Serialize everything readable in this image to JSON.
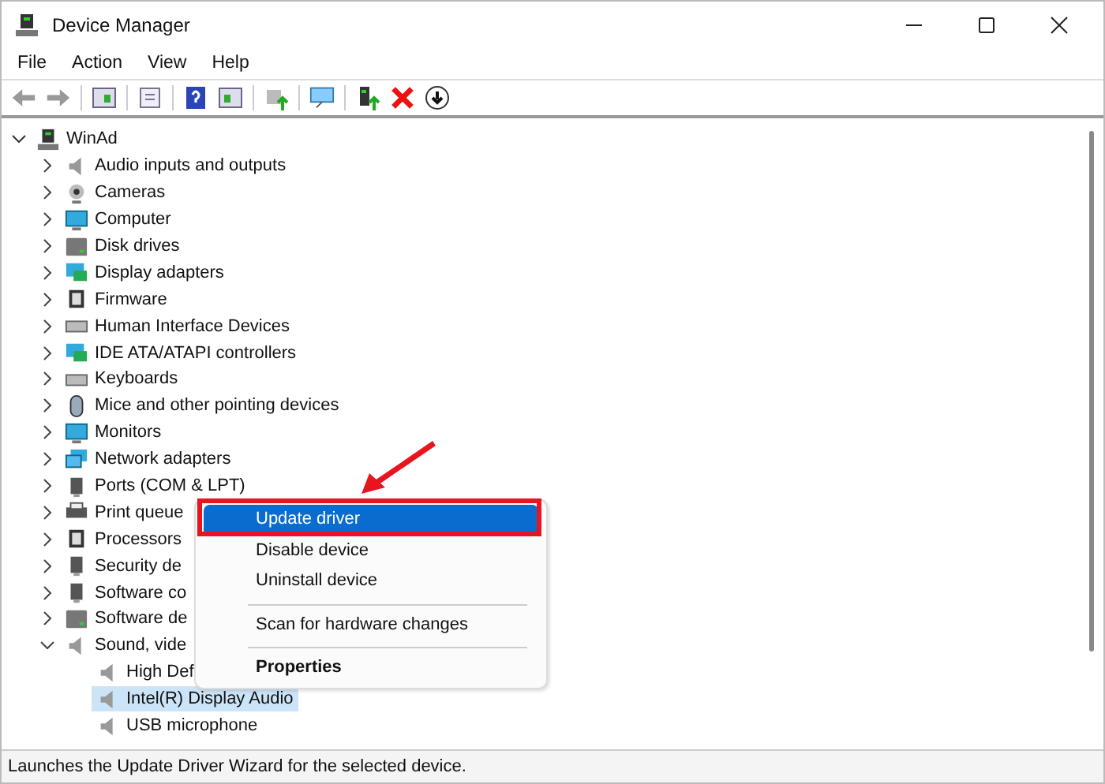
{
  "window": {
    "title": "Device Manager"
  },
  "menu_bar": [
    "File",
    "Action",
    "View",
    "Help"
  ],
  "tree": {
    "label": "WinAd",
    "expanded": true,
    "children": [
      {
        "label": "Audio inputs and outputs",
        "kind": "speaker",
        "expanded": false
      },
      {
        "label": "Cameras",
        "kind": "camera",
        "expanded": false
      },
      {
        "label": "Computer",
        "kind": "monitor",
        "expanded": false
      },
      {
        "label": "Disk drives",
        "kind": "disk",
        "expanded": false
      },
      {
        "label": "Display adapters",
        "kind": "adapter",
        "expanded": false
      },
      {
        "label": "Firmware",
        "kind": "chip",
        "expanded": false
      },
      {
        "label": "Human Interface Devices",
        "kind": "keyboard",
        "expanded": false
      },
      {
        "label": "IDE ATA/ATAPI controllers",
        "kind": "adapter",
        "expanded": false
      },
      {
        "label": "Keyboards",
        "kind": "keyboard",
        "expanded": false
      },
      {
        "label": "Mice and other pointing devices",
        "kind": "mouse",
        "expanded": false
      },
      {
        "label": "Monitors",
        "kind": "monitor",
        "expanded": false
      },
      {
        "label": "Network adapters",
        "kind": "network",
        "expanded": false
      },
      {
        "label": "Ports (COM & LPT)",
        "kind": "port",
        "expanded": false
      },
      {
        "label": "Print queue",
        "kind": "printer",
        "expanded": false
      },
      {
        "label": "Processors",
        "kind": "chip",
        "expanded": false
      },
      {
        "label": "Security de",
        "kind": "port",
        "expanded": false
      },
      {
        "label": "Software co",
        "kind": "port",
        "expanded": false
      },
      {
        "label": "Software de",
        "kind": "disk",
        "expanded": false
      },
      {
        "label": "Sound, vide",
        "kind": "speaker",
        "expanded": true,
        "children": [
          {
            "label": "High Def",
            "kind": "speaker",
            "selected": false
          },
          {
            "label": "Intel(R) Display Audio",
            "kind": "speaker",
            "selected": true
          },
          {
            "label": "USB microphone",
            "kind": "speaker",
            "selected": false
          }
        ]
      }
    ]
  },
  "context_menu": [
    {
      "label": "Update driver",
      "selected": true,
      "default": false,
      "separator_before": false
    },
    {
      "label": "Disable device",
      "selected": false,
      "default": false,
      "separator_before": false
    },
    {
      "label": "Uninstall device",
      "selected": false,
      "default": false,
      "separator_before": false
    },
    {
      "label": "Scan for hardware changes",
      "selected": false,
      "default": false,
      "separator_before": true
    },
    {
      "label": "Properties",
      "selected": false,
      "default": true,
      "separator_before": true
    }
  ],
  "status_bar": "Launches the Update Driver Wizard for the selected device."
}
